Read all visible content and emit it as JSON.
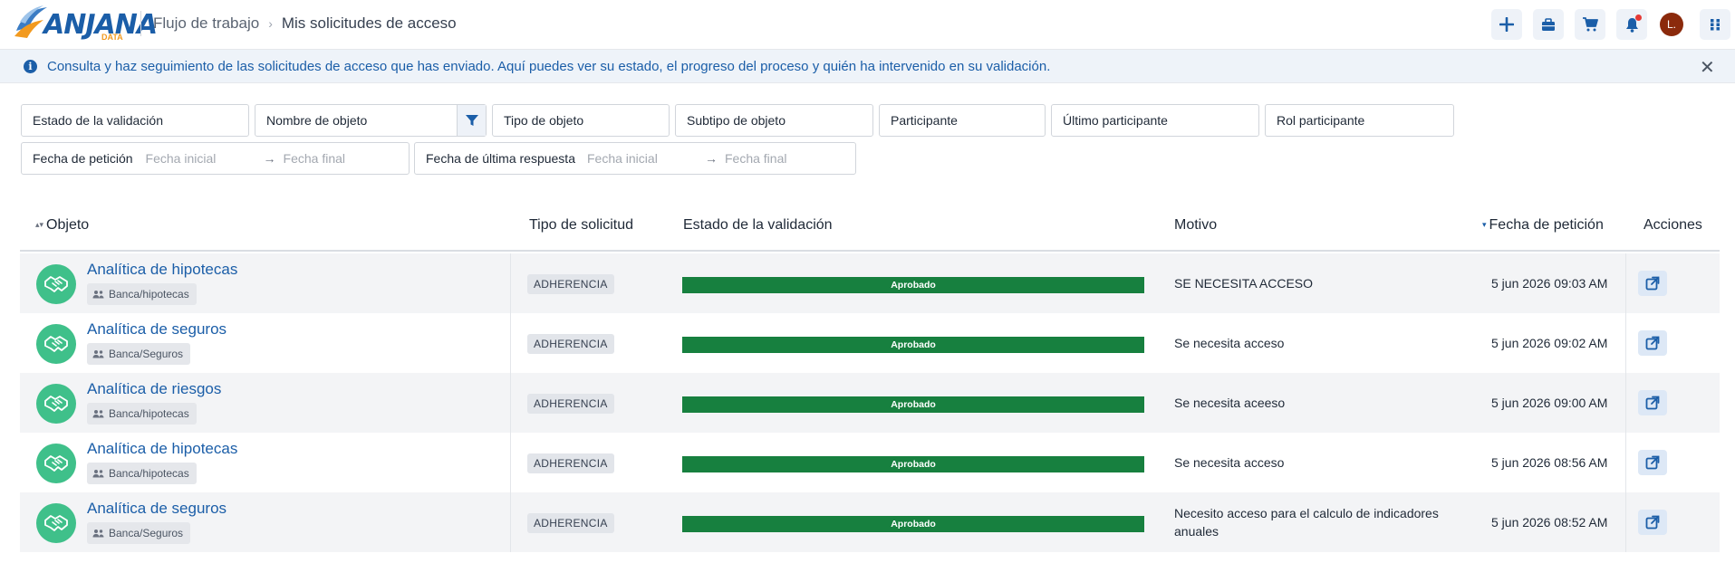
{
  "header": {
    "logo_text": "ANJANA",
    "logo_sub": "DATA",
    "breadcrumb_parent": "Flujo de trabajo",
    "breadcrumb_sep": "›",
    "breadcrumb_current": "Mis solicitudes de acceso",
    "avatar_initial": "L.",
    "buttons": [
      "plus-icon",
      "briefcase-icon",
      "cart-icon",
      "bell-icon",
      "grid-icon"
    ]
  },
  "banner": {
    "text": "Consulta y haz seguimiento de las solicitudes de acceso que has enviado. Aquí puedes ver su estado, el progreso del proceso y quién ha intervenido en su validación.",
    "close": "✕"
  },
  "filters": {
    "estado": "Estado de la validación",
    "nombre": "Nombre de objeto",
    "tipo": "Tipo de objeto",
    "subtipo": "Subtipo de objeto",
    "participante": "Participante",
    "ultimo": "Último participante",
    "rol": "Rol participante",
    "fecha_peticion": "Fecha de petición",
    "fecha_respuesta": "Fecha de última respuesta",
    "fecha_inicial": "Fecha inicial",
    "fecha_final": "Fecha final",
    "arrow": "→"
  },
  "table": {
    "columns": {
      "objeto": "Objeto",
      "tipo": "Tipo de solicitud",
      "estado": "Estado de la validación",
      "motivo": "Motivo",
      "fecha": "Fecha de petición",
      "acciones": "Acciones"
    },
    "rows": [
      {
        "title": "Analítica de hipotecas",
        "chip": "Banca/hipotecas",
        "type": "ADHERENCIA",
        "status": "Aprobado",
        "motive": "SE NECESITA ACCESO",
        "date": "5 jun 2026 09:03 AM"
      },
      {
        "title": "Analítica de seguros",
        "chip": "Banca/Seguros",
        "type": "ADHERENCIA",
        "status": "Aprobado",
        "motive": "Se necesita acceso",
        "date": "5 jun 2026 09:02 AM"
      },
      {
        "title": "Analítica de riesgos",
        "chip": "Banca/hipotecas",
        "type": "ADHERENCIA",
        "status": "Aprobado",
        "motive": "Se necesita aceeso",
        "date": "5 jun 2026 09:00 AM"
      },
      {
        "title": "Analítica de hipotecas",
        "chip": "Banca/hipotecas",
        "type": "ADHERENCIA",
        "status": "Aprobado",
        "motive": "Se necesita acceso",
        "date": "5 jun 2026 08:56 AM"
      },
      {
        "title": "Analítica de seguros",
        "chip": "Banca/Seguros",
        "type": "ADHERENCIA",
        "status": "Aprobado",
        "motive": "Necesito acceso para el calculo de indicadores anuales",
        "date": "5 jun 2026 08:52 AM"
      }
    ]
  },
  "colors": {
    "brand": "#1b5ea8",
    "approved": "#17803f",
    "avatar_green": "#3fc08a",
    "banner_bg": "#eef3f9"
  }
}
